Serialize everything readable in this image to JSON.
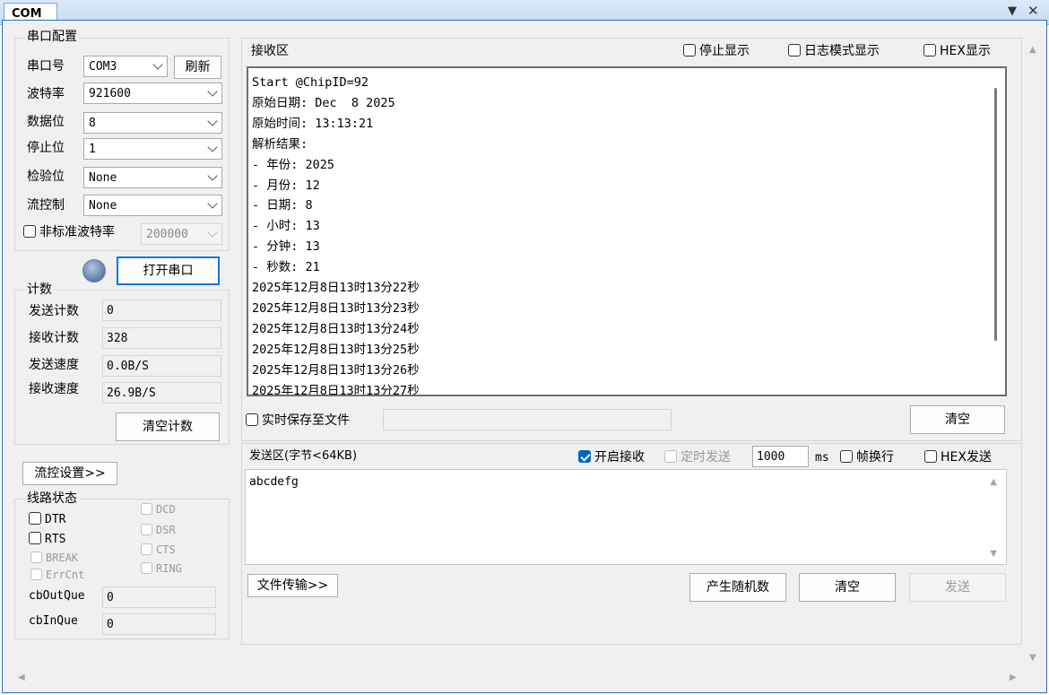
{
  "window": {
    "tab": "COM"
  },
  "serial": {
    "group_title": "串口配置",
    "port_label": "串口号",
    "port_value": "COM3",
    "refresh_label": "刷新",
    "baud_label": "波特率",
    "baud_value": "921600",
    "databits_label": "数据位",
    "databits_value": "8",
    "stopbits_label": "停止位",
    "stopbits_value": "1",
    "parity_label": "检验位",
    "parity_value": "None",
    "flow_label": "流控制",
    "flow_value": "None",
    "nonstd_label": "非标准波特率",
    "nonstd_value": "200000",
    "open_label": "打开串口"
  },
  "counters": {
    "group_title": "计数",
    "send_count_label": "发送计数",
    "send_count": "0",
    "recv_count_label": "接收计数",
    "recv_count": "328",
    "send_speed_label": "发送速度",
    "send_speed": "0.0B/S",
    "recv_speed_label": "接收速度",
    "recv_speed": "26.9B/S",
    "clear_label": "清空计数"
  },
  "flow_settings_label": "流控设置>>",
  "line_status": {
    "group_title": "线路状态",
    "dtr": "DTR",
    "rts": "RTS",
    "break": "BREAK",
    "errcnt": "ErrCnt",
    "dcd": "DCD",
    "dsr": "DSR",
    "cts": "CTS",
    "ring": "RING",
    "outque_label": "cbOutQue",
    "outque_value": "0",
    "inque_label": "cbInQue",
    "inque_value": "0"
  },
  "receive": {
    "title": "接收区",
    "stop_display": "停止显示",
    "log_mode": "日志模式显示",
    "hex_display": "HEX显示",
    "lines": [
      "Start @ChipID=92",
      "原始日期: Dec  8 2025",
      "原始时间: 13:13:21",
      "解析结果:",
      "- 年份: 2025",
      "- 月份: 12",
      "- 日期: 8",
      "- 小时: 13",
      "- 分钟: 13",
      "- 秒数: 21",
      "2025年12月8日13时13分22秒",
      "2025年12月8日13时13分23秒",
      "2025年12月8日13时13分24秒",
      "2025年12月8日13时13分25秒",
      "2025年12月8日13时13分26秒",
      "2025年12月8日13时13分27秒"
    ],
    "save_realtime": "实时保存至文件",
    "clear_label": "清空"
  },
  "send": {
    "title": "发送区(字节<64KB)",
    "enable_receive": "开启接收",
    "timed_send": "定时发送",
    "interval": "1000",
    "interval_unit": "ms",
    "frame_newline": "帧换行",
    "hex_send": "HEX发送",
    "text": "abcdefg",
    "file_transfer": "文件传输>>",
    "random_label": "产生随机数",
    "clear_label": "清空",
    "send_label": "发送"
  }
}
